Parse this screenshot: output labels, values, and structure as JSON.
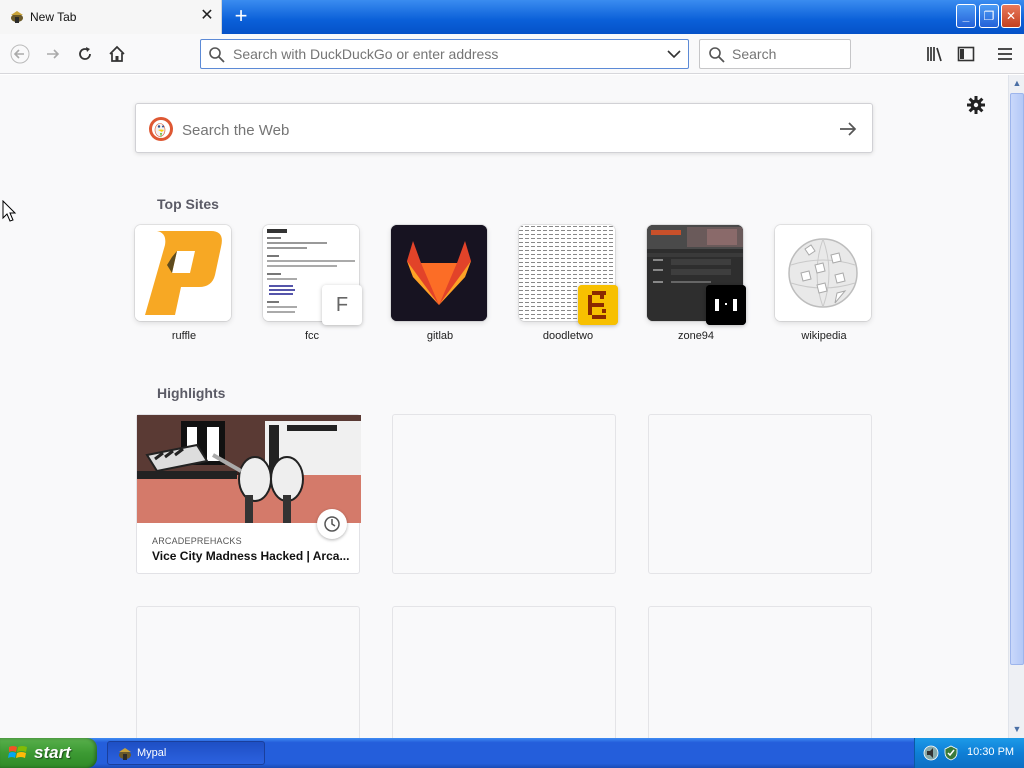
{
  "window": {
    "tab_title": "New Tab",
    "close_tab_symbol": "✕",
    "new_tab_symbol": "+",
    "controls": {
      "minimize": "_",
      "restore": "❐",
      "close": "✕"
    }
  },
  "toolbar": {
    "url_placeholder": "Search with DuckDuckGo or enter address",
    "search_placeholder": "Search"
  },
  "newtab": {
    "web_search_placeholder": "Search the Web",
    "top_sites_title": "Top Sites",
    "top_sites": [
      {
        "label": "ruffle"
      },
      {
        "label": "fcc",
        "badge_letter": "F"
      },
      {
        "label": "gitlab"
      },
      {
        "label": "doodletwo"
      },
      {
        "label": "zone94"
      },
      {
        "label": "wikipedia"
      }
    ],
    "highlights_title": "Highlights",
    "highlights": [
      {
        "source": "ARCADEPREHACKS",
        "title": "Vice City Madness Hacked | Arca..."
      }
    ]
  },
  "taskbar": {
    "start_label": "start",
    "task_label": "Mypal",
    "clock": "10:30 PM"
  },
  "colors": {
    "accent": "#0a84ff",
    "taskbar_blue": "#245edb",
    "start_green": "#3c9a33"
  }
}
